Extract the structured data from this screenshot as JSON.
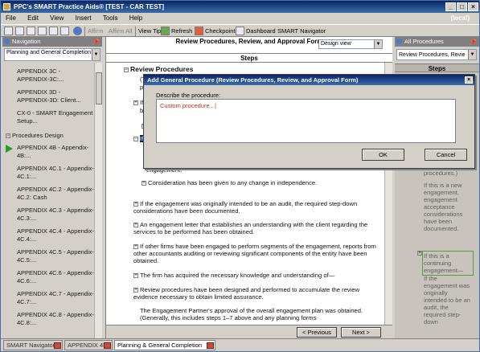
{
  "window": {
    "title": "PPC's SMART Practice Aids® [TEST - CAR TEST]",
    "server": "(local)",
    "minimize": "_",
    "maximize": "□",
    "close": "×"
  },
  "menu": [
    "File",
    "Edit",
    "View",
    "Insert",
    "Tools",
    "Help"
  ],
  "toolbar": {
    "affirm": "Affirm",
    "affirm_all": "Affirm All",
    "view_tip": "View Tip",
    "refresh": "Refresh",
    "checkpoint": "Checkpoint",
    "dashboard": "Dashboard",
    "smart_navigator": "SMART Navigator"
  },
  "navigation": {
    "title": "Navigation",
    "selected": "Planning and General Completion",
    "items": [
      "APPENDIX 3C - APPENDIX-3C:...",
      "APPENDIX 3D - APPENDIX-3D: Client...",
      "CX-0 - SMART Engagement Setup...",
      "Procedures Design",
      "APPENDIX 4B - Appendix-4B:...",
      "APPENDIX 4C.1 - Appendix-4C.1:...",
      "APPENDIX 4C.2 - Appendix-4C.2: Cash",
      "APPENDIX 4C.3 - Appendix-4C.3:...",
      "APPENDIX 4C.4 - Appendix-4C.4:...",
      "APPENDIX 4C.5 - Appendix-4C.5:...",
      "APPENDIX 4C.6 - Appendix-4C.6:...",
      "APPENDIX 4C.7 - Appendix-4C.7:...",
      "APPENDIX 4C.8 - Appendix-4C.8:..."
    ]
  },
  "document": {
    "heading": "Review Procedures, Review, and Approval Form",
    "view": "Design view",
    "steps_label": "Steps",
    "section": "Review Procedures",
    "frag1": "(T",
    "frag2": "pr",
    "frag3": "If",
    "frag4": "be",
    "frag5": "If",
    "frag6": "engagement.",
    "item1": "Consideration has been given to any change in independence.",
    "item2": "If the engagement was originally intended to be an audit, the required step-down considerations have been documented.",
    "item3": "An engagement letter that establishes an understanding with the client regarding the services to be performed has been obtained.",
    "item4": "If other firms have been engaged to perform segments of the engagement, reports from other accountants auditing or reviewing significant components of the entity have been obtained.",
    "item5": "The firm has acquired the necessary knowledge and understanding of—",
    "item6": "Review procedures have been designed and performed to accumulate the review evidence necessary to obtain limited assurance.",
    "item7": "The Engagement Partner's approval of the overall engagement plan was obtained. (Generally, this includes steps 1–7 above and any planning forms",
    "prev": "< Previous",
    "next": "Next >"
  },
  "right_panel": {
    "title": "All Procedures",
    "selected": "Review Procedures, Revie",
    "steps_label": "Steps",
    "text1": "procedures.)",
    "text2": "If this is a new engagement, engagement acceptance considerations have been documented.",
    "text3": "If this is a continuing engagement—",
    "text4": "If the engagement was originally intended to be an audit, the required step-down"
  },
  "status_tabs": [
    "SMART Navigator",
    "APPENDIX 4B",
    "Planning & General Completion"
  ],
  "dialog": {
    "title": "Add General Procedure (Review Procedures, Review, and Approval Form)",
    "label": "Describe the procedure:",
    "value": "Custom procedure...|",
    "ok": "OK",
    "cancel": "Cancel"
  },
  "colors": {
    "title_bar": "#0a246a",
    "dialog_text": "#c0301a",
    "nav_arrow": "#2a9a2a"
  }
}
